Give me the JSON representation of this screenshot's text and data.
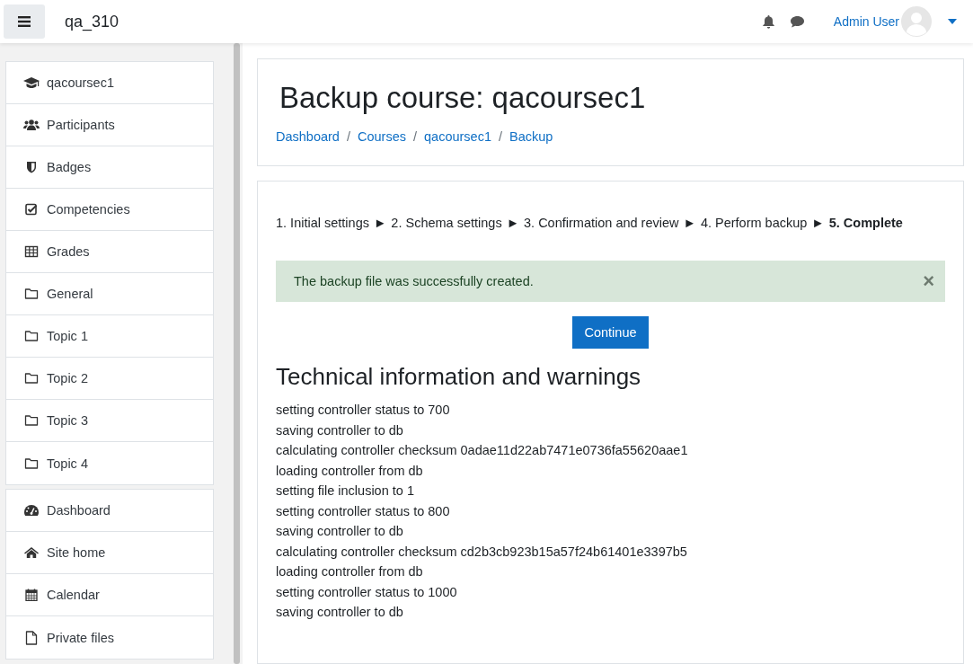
{
  "navbar": {
    "site_name": "qa_310",
    "user_name": "Admin User"
  },
  "sidebar": {
    "groups": [
      [
        {
          "label": "qacoursec1",
          "kind": "course"
        },
        {
          "label": "Participants",
          "kind": "users"
        },
        {
          "label": "Badges",
          "kind": "shield"
        },
        {
          "label": "Competencies",
          "kind": "checkbox"
        },
        {
          "label": "Grades",
          "kind": "table"
        },
        {
          "label": "General",
          "kind": "folder"
        },
        {
          "label": "Topic 1",
          "kind": "folder"
        },
        {
          "label": "Topic 2",
          "kind": "folder"
        },
        {
          "label": "Topic 3",
          "kind": "folder"
        },
        {
          "label": "Topic 4",
          "kind": "folder"
        }
      ],
      [
        {
          "label": "Dashboard",
          "kind": "gauge"
        },
        {
          "label": "Site home",
          "kind": "home"
        },
        {
          "label": "Calendar",
          "kind": "calendar"
        },
        {
          "label": "Private files",
          "kind": "file"
        }
      ]
    ]
  },
  "header": {
    "title": "Backup course: qacoursec1",
    "breadcrumbs": [
      "Dashboard",
      "Courses",
      "qacoursec1",
      "Backup"
    ],
    "breadcrumb_separator": "/"
  },
  "steps": {
    "separator": "►",
    "items": [
      {
        "label": "1. Initial settings",
        "current": false
      },
      {
        "label": "2. Schema settings",
        "current": false
      },
      {
        "label": "3. Confirmation and review",
        "current": false
      },
      {
        "label": "4. Perform backup",
        "current": false
      },
      {
        "label": "5. Complete",
        "current": true
      }
    ]
  },
  "alert": {
    "message": "The backup file was successfully created.",
    "close": "×"
  },
  "continue_button": "Continue",
  "technical": {
    "heading": "Technical information and warnings",
    "lines": [
      "setting controller status to 700",
      "saving controller to db",
      "calculating controller checksum 0adae11d22ab7471e0736fa55620aae1",
      "loading controller from db",
      "setting file inclusion to 1",
      "setting controller status to 800",
      "saving controller to db",
      "calculating controller checksum cd2b3cb923b15a57f24b61401e3397b5",
      "loading controller from db",
      "setting controller status to 1000",
      "saving controller to db"
    ]
  }
}
